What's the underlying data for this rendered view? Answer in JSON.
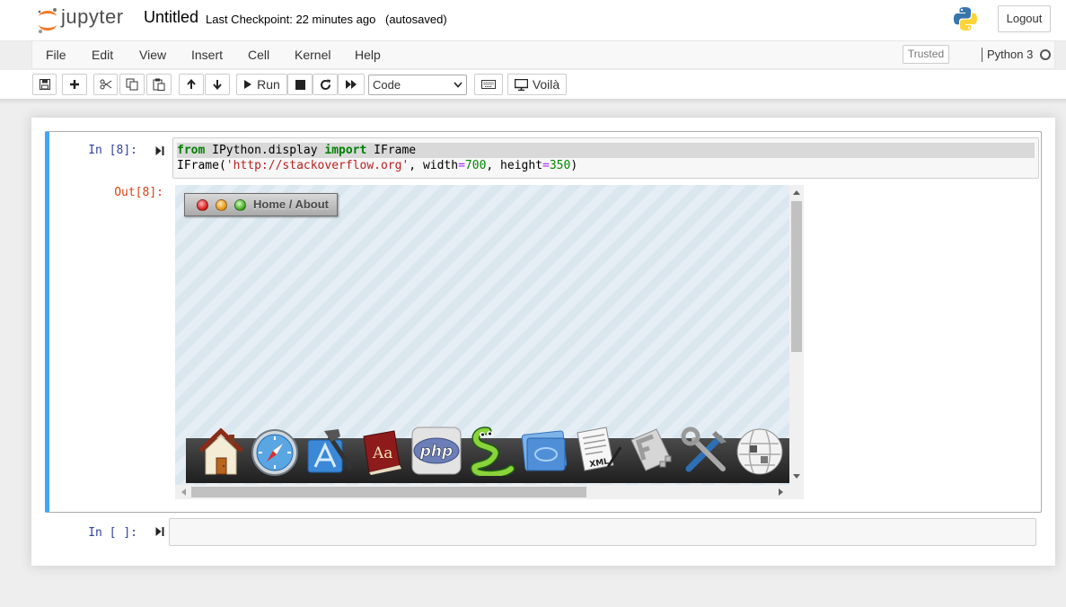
{
  "header": {
    "logo_text": "jupyter",
    "notebook_title": "Untitled",
    "checkpoint": "Last Checkpoint: 22 minutes ago",
    "autosaved": "(autosaved)",
    "logout_label": "Logout"
  },
  "menubar": {
    "items": [
      "File",
      "Edit",
      "View",
      "Insert",
      "Cell",
      "Kernel",
      "Help"
    ],
    "trusted_label": "Trusted",
    "kernel_name": "Python 3"
  },
  "toolbar": {
    "buttons": [
      "save-icon",
      "plus-icon",
      "cut-icon",
      "copy-icon",
      "paste-icon",
      "arrow-up-icon",
      "arrow-down-icon",
      "run-icon",
      "stop-icon",
      "restart-icon",
      "fast-forward-icon",
      "keyboard-icon",
      "voila-icon"
    ],
    "run_label": "Run",
    "cell_type": "Code",
    "voila_label": "Voilà"
  },
  "cells": [
    {
      "in_prompt": "In [8]:",
      "code_lines": [
        [
          {
            "t": "from",
            "c": "kw"
          },
          {
            "t": " IPython.display ",
            "c": ""
          },
          {
            "t": "import",
            "c": "kw"
          },
          {
            "t": " IFrame",
            "c": ""
          }
        ],
        [
          {
            "t": "IFrame(",
            "c": ""
          },
          {
            "t": "'http://stackoverflow.org'",
            "c": "str"
          },
          {
            "t": ", width",
            "c": ""
          },
          {
            "t": "=",
            "c": "op"
          },
          {
            "t": "700",
            "c": "num"
          },
          {
            "t": ", height",
            "c": ""
          },
          {
            "t": "=",
            "c": "op"
          },
          {
            "t": "350",
            "c": "num"
          },
          {
            "t": ")",
            "c": ""
          }
        ]
      ],
      "out_prompt": "Out[8]:",
      "iframe": {
        "title": "Home / About",
        "dock_icons": [
          "home-icon",
          "safari-compass-icon",
          "xcode-icon",
          "dictionary-icon",
          "php-icon",
          "python-snake-icon",
          "photo-folder-icon",
          "xml-document-icon",
          "font-f-icon",
          "tools-icon",
          "wikipedia-globe-icon"
        ],
        "dock_labels": {
          "dictionary": "Aa",
          "php": "php",
          "xml": "XML"
        }
      }
    },
    {
      "in_prompt": "In [ ]:"
    }
  ]
}
